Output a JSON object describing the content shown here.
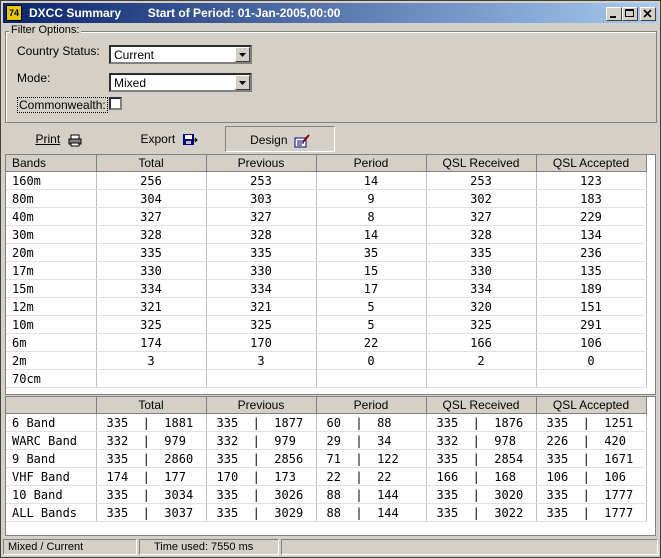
{
  "window": {
    "title": "DXCC Summary        Start of Period: 01-Jan-2005,00:00",
    "app_icon": "74"
  },
  "filter": {
    "legend": "Filter Options:",
    "country_status_label": "Country Status:",
    "country_status_value": "Current",
    "mode_label": "Mode:",
    "mode_value": "Mixed",
    "commonwealth_label": "Commonwealth:",
    "commonwealth_checked": false
  },
  "toolbar": {
    "print_label": "Print",
    "export_label": "Export",
    "design_label": "Design"
  },
  "bands_table": {
    "columns": [
      "Bands",
      "Total",
      "Previous",
      "Period",
      "QSL Received",
      "QSL Accepted"
    ],
    "rows": [
      [
        "160m",
        "256",
        "253",
        "14",
        "253",
        "123"
      ],
      [
        "80m",
        "304",
        "303",
        "9",
        "302",
        "183"
      ],
      [
        "40m",
        "327",
        "327",
        "8",
        "327",
        "229"
      ],
      [
        "30m",
        "328",
        "328",
        "14",
        "328",
        "134"
      ],
      [
        "20m",
        "335",
        "335",
        "35",
        "335",
        "236"
      ],
      [
        "17m",
        "330",
        "330",
        "15",
        "330",
        "135"
      ],
      [
        "15m",
        "334",
        "334",
        "17",
        "334",
        "189"
      ],
      [
        "12m",
        "321",
        "321",
        "5",
        "320",
        "151"
      ],
      [
        "10m",
        "325",
        "325",
        "5",
        "325",
        "291"
      ],
      [
        "6m",
        "174",
        "170",
        "22",
        "166",
        "106"
      ],
      [
        "2m",
        "3",
        "3",
        "0",
        "2",
        "0"
      ],
      [
        "70cm",
        "",
        "",
        "",
        "",
        ""
      ]
    ]
  },
  "summary_table": {
    "columns": [
      "",
      "Total",
      "Previous",
      "Period",
      "QSL Received",
      "QSL Accepted"
    ],
    "rows": [
      [
        "6 Band",
        "335  |  1881",
        "335  |  1877",
        "60  |  88",
        "335  |  1876",
        "335  |  1251"
      ],
      [
        "WARC Band",
        "332  |  979",
        "332  |  979",
        "29  |  34",
        "332  |  978",
        "226  |  420"
      ],
      [
        "9 Band",
        "335  |  2860",
        "335  |  2856",
        "71  |  122",
        "335  |  2854",
        "335  |  1671"
      ],
      [
        "VHF Band",
        "174  |  177",
        "170  |  173",
        "22  |  22",
        "166  |  168",
        "106  |  106"
      ],
      [
        "10 Band",
        "335  |  3034",
        "335  |  3026",
        "88  |  144",
        "335  |  3020",
        "335  |  1777"
      ],
      [
        "ALL Bands",
        "335  |  3037",
        "335  |  3029",
        "88  |  144",
        "335  |  3022",
        "335  |  1777"
      ]
    ]
  },
  "status": {
    "mode_status": "Mixed / Current",
    "time_used": "Time used: 7550 ms"
  }
}
